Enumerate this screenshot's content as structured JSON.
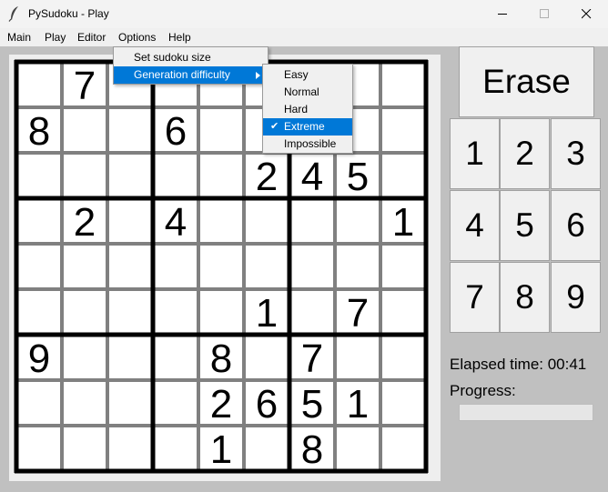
{
  "window": {
    "title": "PySudoku - Play",
    "icon": "feather-icon",
    "controls": [
      "minimize-icon",
      "maximize-icon",
      "close-icon"
    ]
  },
  "menubar": {
    "items": [
      "Main",
      "Play",
      "Editor",
      "Options",
      "Help"
    ]
  },
  "options_menu": {
    "items": [
      "Set sudoku size",
      "Generation difficulty"
    ],
    "highlighted": "Generation difficulty"
  },
  "difficulty_submenu": {
    "items": [
      "Easy",
      "Normal",
      "Hard",
      "Extreme",
      "Impossible"
    ],
    "selected": "Extreme"
  },
  "board": {
    "size": 9,
    "cells": [
      [
        "",
        "7",
        "",
        "",
        "",
        "",
        "",
        "",
        ""
      ],
      [
        "8",
        "",
        "",
        "6",
        "",
        "",
        "",
        "",
        ""
      ],
      [
        "",
        "",
        "",
        "",
        "",
        "2",
        "4",
        "5",
        ""
      ],
      [
        "",
        "2",
        "",
        "4",
        "",
        "",
        "",
        "",
        "1"
      ],
      [
        "",
        "",
        "",
        "",
        "",
        "",
        "",
        "",
        ""
      ],
      [
        "",
        "",
        "",
        "",
        "",
        "1",
        "",
        "7",
        ""
      ],
      [
        "9",
        "",
        "",
        "",
        "8",
        "",
        "7",
        "",
        ""
      ],
      [
        "",
        "",
        "",
        "",
        "2",
        "6",
        "5",
        "1",
        ""
      ],
      [
        "",
        "",
        "",
        "",
        "1",
        "",
        "8",
        "",
        ""
      ]
    ]
  },
  "controls": {
    "erase_label": "Erase",
    "number_buttons": [
      "1",
      "2",
      "3",
      "4",
      "5",
      "6",
      "7",
      "8",
      "9"
    ]
  },
  "status": {
    "elapsed_text": "Elapsed time: 00:41",
    "progress_label": "Progress:",
    "progress_fraction": 0
  },
  "colors": {
    "menu_highlight": "#0078d7",
    "background": "#c0c0c0",
    "board_background": "#ffffff",
    "grid_thin": "#808080",
    "grid_thick": "#000000"
  }
}
